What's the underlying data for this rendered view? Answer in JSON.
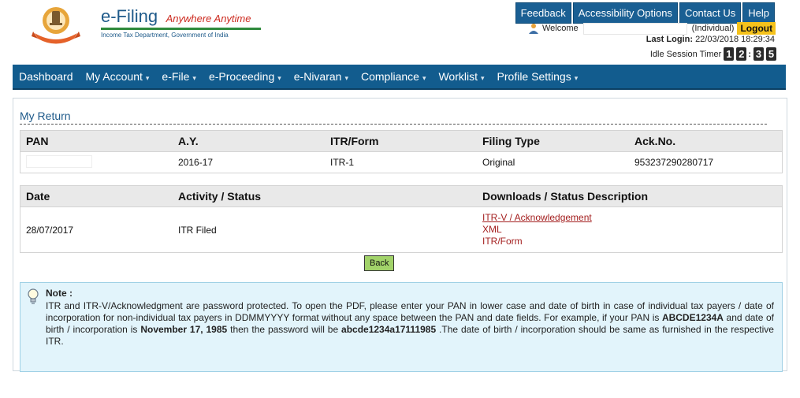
{
  "header": {
    "brand_title": "e-Filing",
    "brand_tagline": "Anywhere Anytime",
    "brand_subtitle": "Income Tax Department, Government of India",
    "logo_caption": "INCOME TAX DEPARTMENT",
    "top_links": [
      "Feedback",
      "Accessibility Options",
      "Contact Us",
      "Help"
    ],
    "welcome": "Welcome",
    "user_type": "(Individual)",
    "logout": "Logout",
    "last_login_label": "Last Login:",
    "last_login_value": "22/03/2018 18:29:34",
    "idle_label": "Idle Session Timer",
    "timer_digits": [
      "1",
      "2",
      "3",
      "5"
    ]
  },
  "nav": {
    "items": [
      "Dashboard",
      "My Account",
      "e-File",
      "e-Proceeding",
      "e-Nivaran",
      "Compliance",
      "Worklist",
      "Profile Settings"
    ]
  },
  "main": {
    "section_title": "My Return",
    "return_table": {
      "headers": [
        "PAN",
        "A.Y.",
        "ITR/Form",
        "Filing Type",
        "Ack.No."
      ],
      "row": {
        "ay": "2016-17",
        "form": "ITR-1",
        "filing_type": "Original",
        "ack_no": "953237290280717"
      }
    },
    "activity_table": {
      "headers": [
        "Date",
        "Activity / Status",
        "Downloads / Status Description"
      ],
      "row": {
        "date": "28/07/2017",
        "status": "ITR Filed",
        "downloads": [
          "ITR-V / Acknowledgement",
          "XML",
          "ITR/Form"
        ]
      }
    },
    "back_label": "Back",
    "note": {
      "label": "Note :",
      "p1": "ITR and ITR-V/Acknowledgment are password protected. To open the PDF, please enter your PAN in lower case and date of birth in case of individual tax payers / date of incorporation for non-individual tax payers in DDMMYYYY format without any space between the PAN and date fields. For example, if your PAN is ",
      "pan_example": "ABCDE1234A",
      "p2": " and date of birth / incorporation is ",
      "date_example": "November 17, 1985",
      "p3": " then the password will be ",
      "password_example": "abcde1234a17111985",
      "p4": " .The date of birth / incorporation should be same as furnished in the respective ITR."
    }
  },
  "colors": {
    "nav_bg": "#125c8e",
    "logout_bg": "#f5c21b",
    "back_bg": "#a2d36a",
    "note_bg": "#e2f4fb",
    "link_color": "#a42020"
  }
}
